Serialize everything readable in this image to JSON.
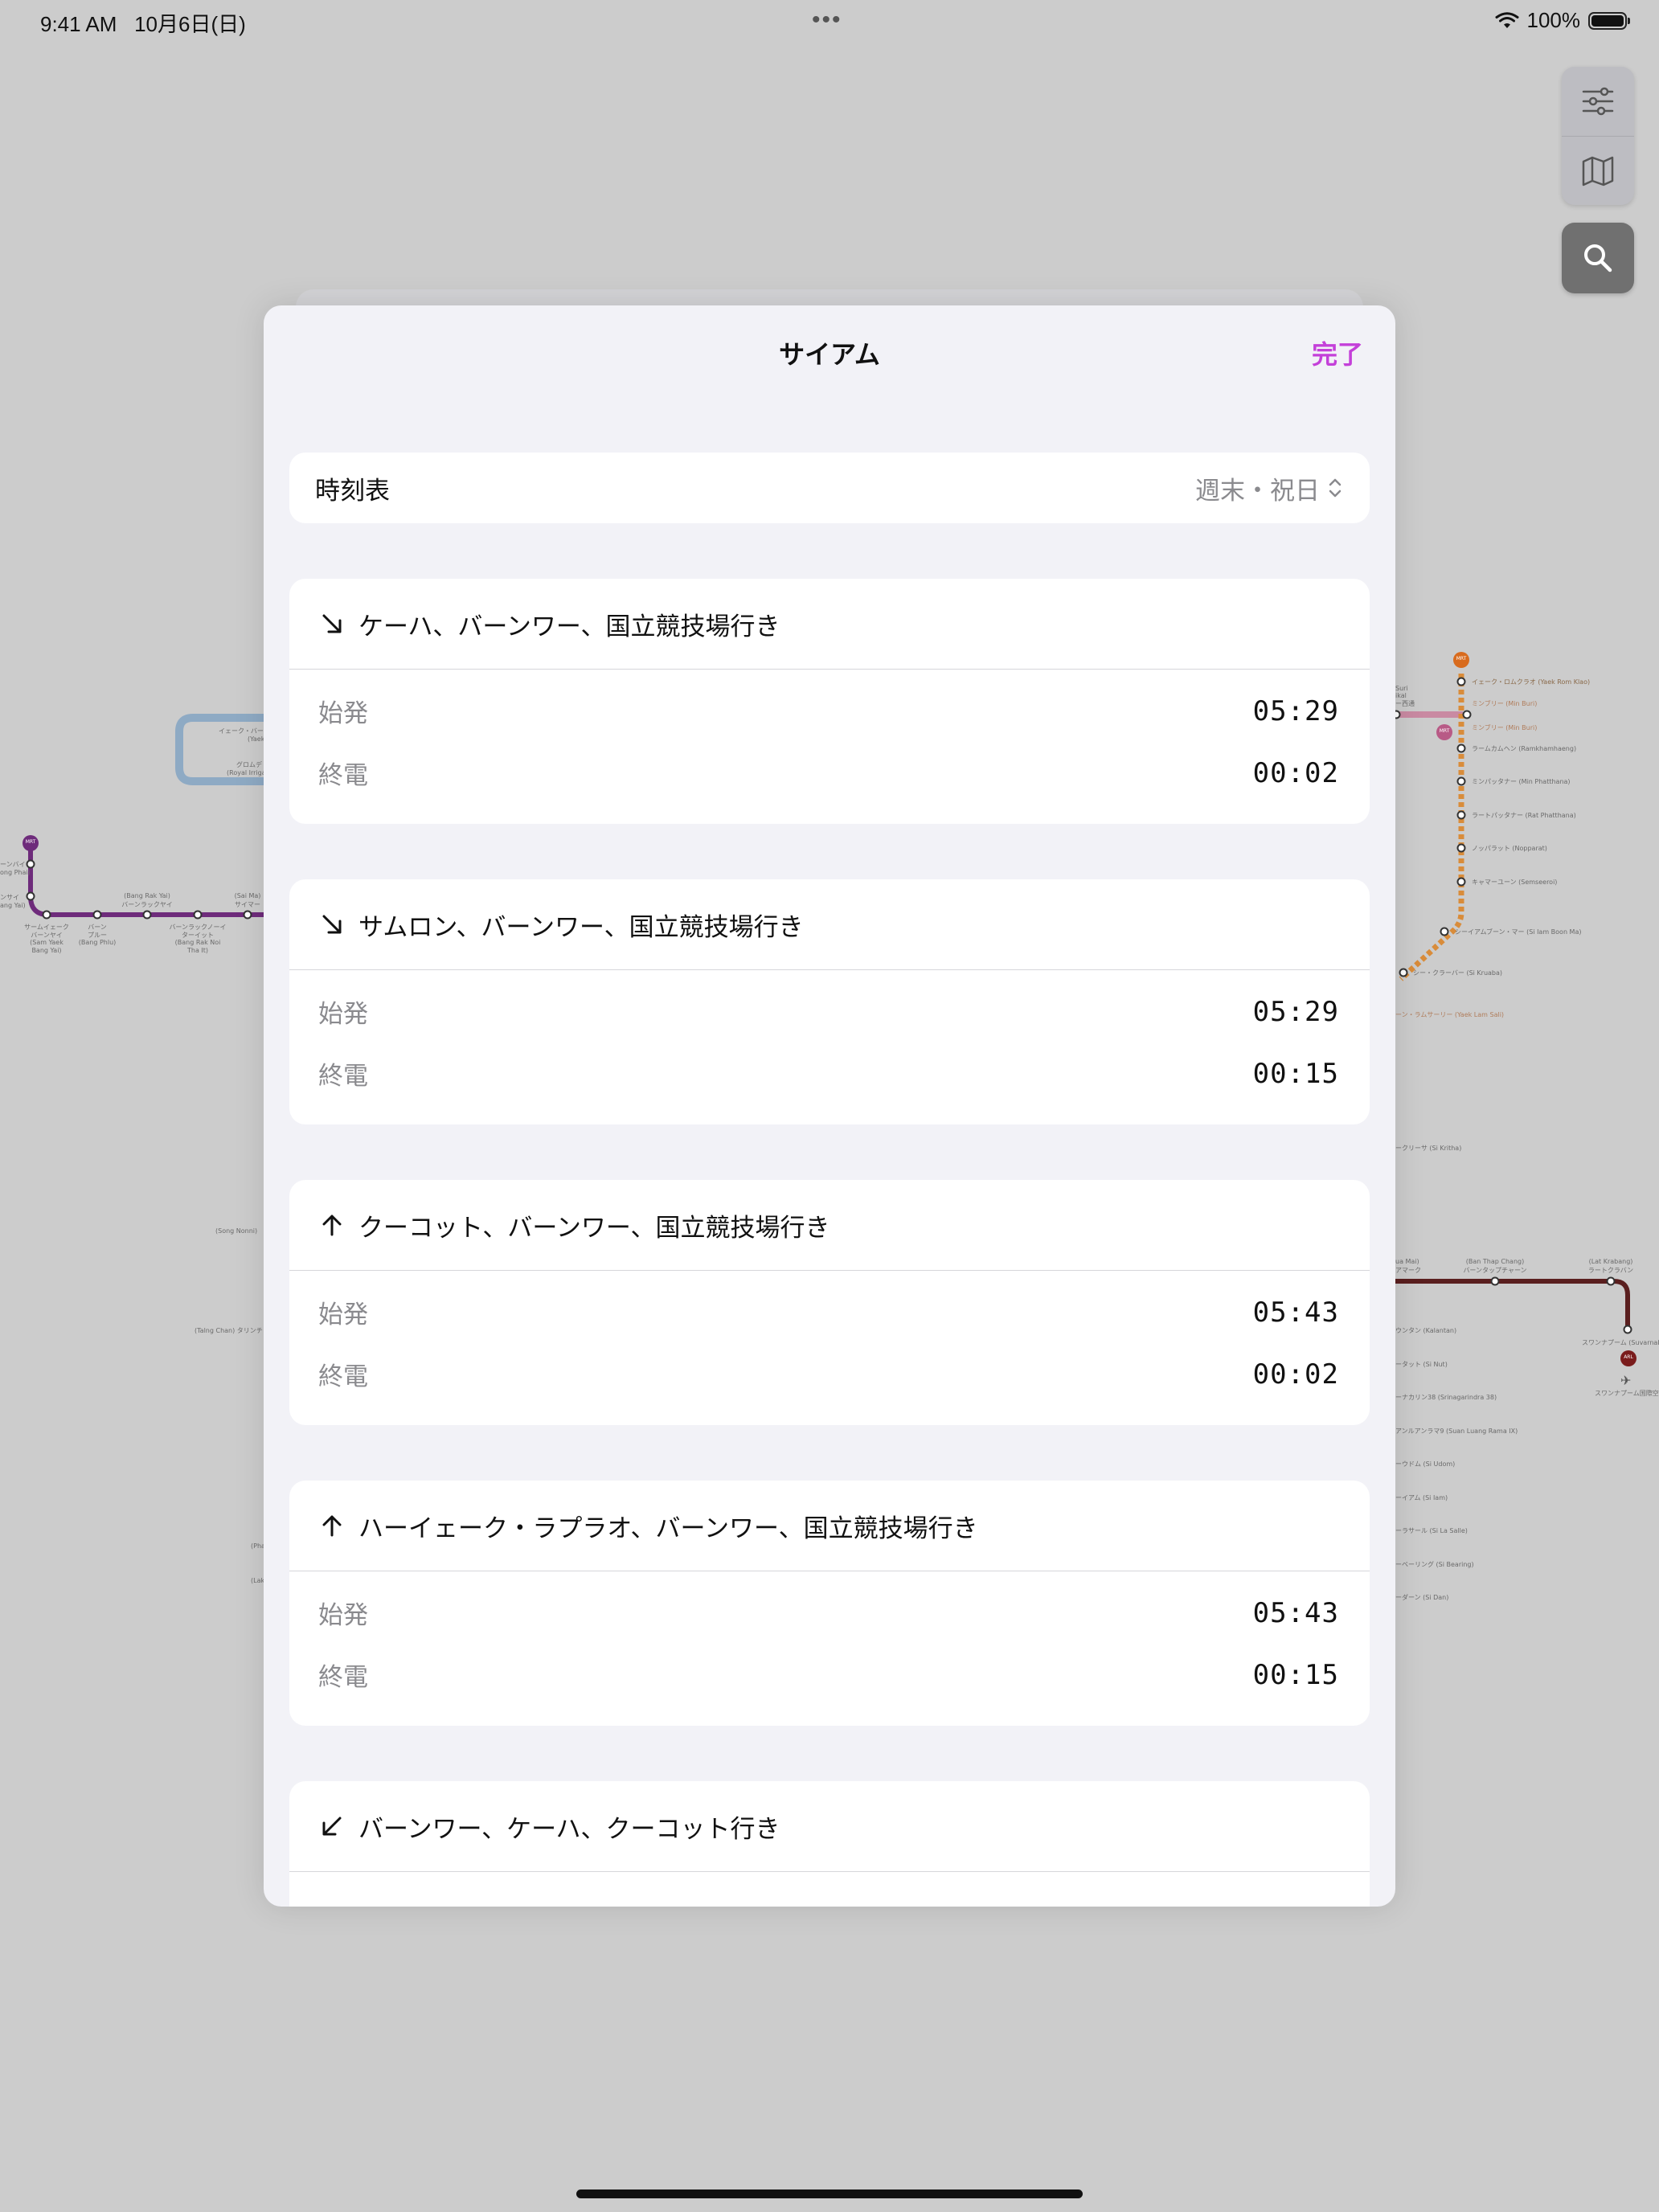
{
  "status_bar": {
    "time": "9:41 AM   10月6日(日)",
    "dots": "•••",
    "battery_percent": "100%"
  },
  "sheet": {
    "title": "サイアム",
    "done_label": "完了"
  },
  "timetable": {
    "label": "時刻表",
    "selected_value": "週末・祝日"
  },
  "directions": [
    {
      "arrow": "arrow-down-right",
      "destination": "ケーハ、バーンワー、国立競技場行き",
      "first_label": "始発",
      "first_time": "05:29",
      "last_label": "終電",
      "last_time": "00:02"
    },
    {
      "arrow": "arrow-down-right",
      "destination": "サムロン、バーンワー、国立競技場行き",
      "first_label": "始発",
      "first_time": "05:29",
      "last_label": "終電",
      "last_time": "00:15"
    },
    {
      "arrow": "arrow-up",
      "destination": "クーコット、バーンワー、国立競技場行き",
      "first_label": "始発",
      "first_time": "05:43",
      "last_label": "終電",
      "last_time": "00:02"
    },
    {
      "arrow": "arrow-up",
      "destination": "ハーイェーク・ラプラオ、バーンワー、国立競技場行き",
      "first_label": "始発",
      "first_time": "05:43",
      "last_label": "終電",
      "last_time": "00:15"
    },
    {
      "arrow": "arrow-down-left",
      "destination": "バーンワー、ケーハ、クーコット行き"
    }
  ],
  "map": {
    "badges": [
      "MRT",
      "MRT",
      "MRT",
      "ARL"
    ],
    "labels_left": [
      "イェーク・バー",
      "(Yaek",
      "グロムデ",
      "(Royal Irriga",
      "ーンバイ",
      "ong Phai)",
      "ンサイ",
      "ang Yai)",
      "サームイェーク",
      "バーンヤイ",
      "(Sam Yaek",
      "Bang Yai)",
      "バーン",
      "プルー",
      "(Bang Phlu)",
      "(Bang Rak Yai)",
      "バーンラックヤイ",
      "バーンラックノーイ",
      "ターイット",
      "(Bang Rak Noi",
      "Tha It)",
      "(Sai Ma)",
      "サイマー",
      "(Song Nonni)",
      "(Talng Chan) タリンチャ",
      "(Pha",
      "(Lak"
    ],
    "labels_right_orange": [
      "イェーク・ロムクラオ (Yaek Rom Klao)",
      "ミンブリー (Min Buri)",
      "ミンブリー (Min Buri)",
      "ラームカムヘン (Ramkhamhaeng)",
      "ミンパッタナー (Min Phatthana)",
      "ラートパッタナー (Rat Phatthana)",
      "ノッパラット (Nopparat)",
      "キャマーユーン (Semseeroi)",
      "シーイアムブーン・マー (Si Iam Boon Ma)",
      "シー・クラーバー (Si Kruaba)",
      "ーン・ラムサーリー (Yaek Lam Sali)"
    ],
    "labels_right_top": [
      "Suri",
      "ikal",
      "ー西通"
    ],
    "label_sikritha": "ークリーサ (Si Kritha)",
    "labels_right_red_line": [
      "ua Mai)",
      "アマーク",
      "(Ban Thap Chang)",
      "バーンタップチャーン",
      "(Lat Krabang)",
      "ラートクラバン",
      "スワンナプーム (Suvarnabh",
      "スワンナプーム国際空"
    ],
    "labels_right_list": [
      "ウンタン (Kalantan)",
      "ータット (Si Nut)",
      "ーナカリン38 (Srinagarindra 38)",
      "アンルアンラマ9 (Suan Luang Rama IX)",
      "ーウドム (Si Udom)",
      "ーイアム (Si Iam)",
      "ーラサール (Si La Salle)",
      "ーベーリング (Si Bearing)",
      "ーダーン (Si Dan)"
    ]
  }
}
